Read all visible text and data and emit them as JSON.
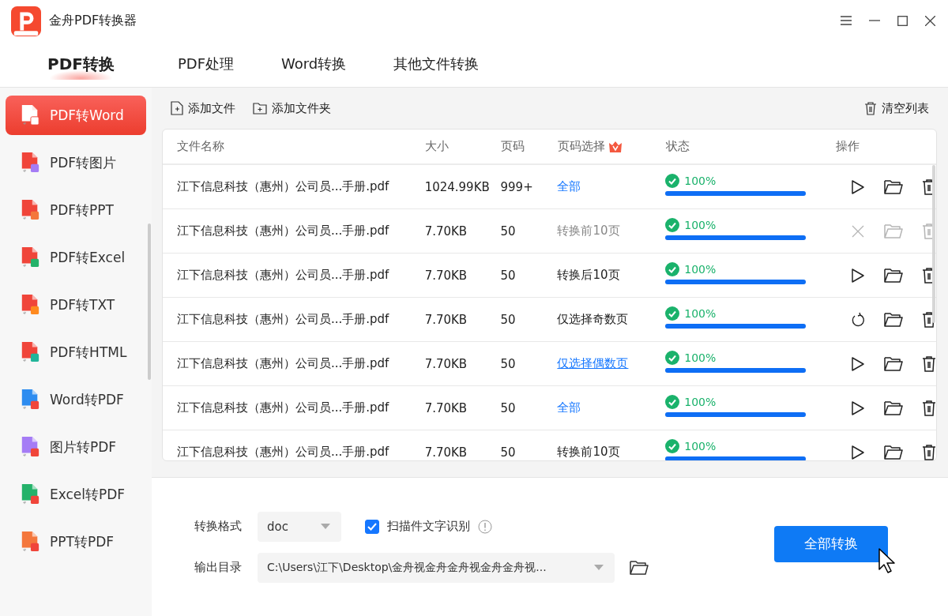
{
  "window": {
    "title": "金舟PDF转换器"
  },
  "tabs": [
    {
      "label": "PDF转换",
      "selected": true
    },
    {
      "label": "PDF处理",
      "selected": false
    },
    {
      "label": "Word转换",
      "selected": false
    },
    {
      "label": "其他文件转换",
      "selected": false
    }
  ],
  "sidebar": {
    "items": [
      {
        "label": "PDF转Word",
        "selected": true,
        "kind": "toword"
      },
      {
        "label": "PDF转图片",
        "selected": false,
        "kind": "toimage"
      },
      {
        "label": "PDF转PPT",
        "selected": false,
        "kind": "toppt"
      },
      {
        "label": "PDF转Excel",
        "selected": false,
        "kind": "toexcel"
      },
      {
        "label": "PDF转TXT",
        "selected": false,
        "kind": "totxt"
      },
      {
        "label": "PDF转HTML",
        "selected": false,
        "kind": "tohtml"
      },
      {
        "label": "Word转PDF",
        "selected": false,
        "kind": "fromword"
      },
      {
        "label": "图片转PDF",
        "selected": false,
        "kind": "fromimage"
      },
      {
        "label": "Excel转PDF",
        "selected": false,
        "kind": "fromexcel"
      },
      {
        "label": "PPT转PDF",
        "selected": false,
        "kind": "fromppt"
      }
    ]
  },
  "toolbar": {
    "add_file": "添加文件",
    "add_folder": "添加文件夹",
    "clear": "清空列表"
  },
  "table": {
    "columns": [
      "文件名称",
      "大小",
      "页码",
      "页码选择",
      "状态",
      "操作"
    ],
    "rows": [
      {
        "name": "江下信息科技（惠州）公司员...手册.pdf",
        "size": "1024.99KB",
        "pages": "999+",
        "range": {
          "text": "全部",
          "kind": "link"
        },
        "status": "100%",
        "level": 1,
        "kind": "play",
        "disabled": false
      },
      {
        "name": "江下信息科技（惠州）公司员...手册.pdf",
        "size": "7.70KB",
        "pages": "50",
        "range": {
          "text": "转换前10页",
          "kind": "muted"
        },
        "status": "100%",
        "level": 1,
        "kind": "cancel",
        "disabled": true
      },
      {
        "name": "江下信息科技（惠州）公司员...手册.pdf",
        "size": "7.70KB",
        "pages": "50",
        "range": {
          "text": "转换后10页",
          "kind": "plain"
        },
        "status": "100%",
        "level": 1,
        "kind": "play",
        "disabled": false
      },
      {
        "name": "江下信息科技（惠州）公司员...手册.pdf",
        "size": "7.70KB",
        "pages": "50",
        "range": {
          "text": "仅选择奇数页",
          "kind": "plain"
        },
        "status": "100%",
        "level": 1,
        "kind": "retry",
        "disabled": false
      },
      {
        "name": "江下信息科技（惠州）公司员...手册.pdf",
        "size": "7.70KB",
        "pages": "50",
        "range": {
          "text": "仅选择偶数页",
          "kind": "underlined"
        },
        "status": "100%",
        "level": 1,
        "kind": "play",
        "disabled": false
      },
      {
        "name": "江下信息科技（惠州）公司员...手册.pdf",
        "size": "7.70KB",
        "pages": "50",
        "range": {
          "text": "全部",
          "kind": "link"
        },
        "status": "100%",
        "level": 1,
        "kind": "play",
        "disabled": false
      },
      {
        "name": "江下信息科技（惠州）公司员...手册.pdf",
        "size": "7.70KB",
        "pages": "50",
        "range": {
          "text": "转换前10页",
          "kind": "plain"
        },
        "status": "100%",
        "level": 1,
        "kind": "play",
        "disabled": false
      }
    ]
  },
  "settings": {
    "format_label": "转换格式",
    "format": "doc",
    "ocr_label": "扫描件文字识别",
    "ocr_checked": true,
    "output_label": "输出目录",
    "output_path": "C:\\Users\\江下\\Desktop\\金舟视金舟金舟视金舟金舟视..."
  },
  "convert_button": "全部转换"
}
